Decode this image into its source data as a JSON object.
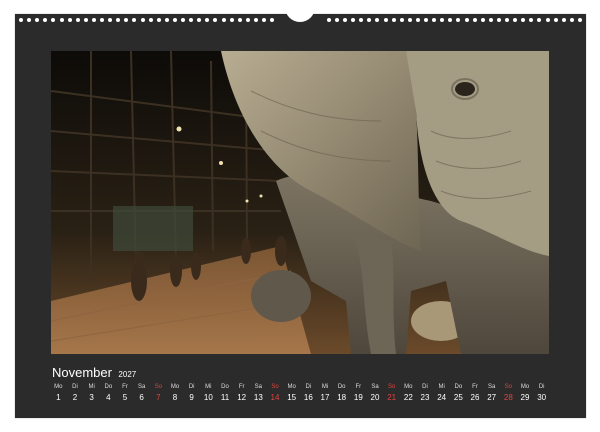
{
  "calendar": {
    "month": "November",
    "year": "2027",
    "days": [
      {
        "dow": "Mo",
        "num": "1",
        "sunday": false
      },
      {
        "dow": "Di",
        "num": "2",
        "sunday": false
      },
      {
        "dow": "Mi",
        "num": "3",
        "sunday": false
      },
      {
        "dow": "Do",
        "num": "4",
        "sunday": false
      },
      {
        "dow": "Fr",
        "num": "5",
        "sunday": false
      },
      {
        "dow": "Sa",
        "num": "6",
        "sunday": false
      },
      {
        "dow": "So",
        "num": "7",
        "sunday": true
      },
      {
        "dow": "Mo",
        "num": "8",
        "sunday": false
      },
      {
        "dow": "Di",
        "num": "9",
        "sunday": false
      },
      {
        "dow": "Mi",
        "num": "10",
        "sunday": false
      },
      {
        "dow": "Do",
        "num": "11",
        "sunday": false
      },
      {
        "dow": "Fr",
        "num": "12",
        "sunday": false
      },
      {
        "dow": "Sa",
        "num": "13",
        "sunday": false
      },
      {
        "dow": "So",
        "num": "14",
        "sunday": true
      },
      {
        "dow": "Mo",
        "num": "15",
        "sunday": false
      },
      {
        "dow": "Di",
        "num": "16",
        "sunday": false
      },
      {
        "dow": "Mi",
        "num": "17",
        "sunday": false
      },
      {
        "dow": "Do",
        "num": "18",
        "sunday": false
      },
      {
        "dow": "Fr",
        "num": "19",
        "sunday": false
      },
      {
        "dow": "Sa",
        "num": "20",
        "sunday": false
      },
      {
        "dow": "So",
        "num": "21",
        "sunday": true
      },
      {
        "dow": "Mo",
        "num": "22",
        "sunday": false
      },
      {
        "dow": "Di",
        "num": "23",
        "sunday": false
      },
      {
        "dow": "Mi",
        "num": "24",
        "sunday": false
      },
      {
        "dow": "Do",
        "num": "25",
        "sunday": false
      },
      {
        "dow": "Fr",
        "num": "26",
        "sunday": false
      },
      {
        "dow": "Sa",
        "num": "27",
        "sunday": false
      },
      {
        "dow": "So",
        "num": "28",
        "sunday": true
      },
      {
        "dow": "Mo",
        "num": "29",
        "sunday": false
      },
      {
        "dow": "Di",
        "num": "30",
        "sunday": false
      }
    ]
  },
  "colors": {
    "sheet": "#2b2b2b",
    "sunday": "#e0433d",
    "text": "#ffffff"
  },
  "photo": {
    "subject": "elephant-museum-hall-photo"
  }
}
